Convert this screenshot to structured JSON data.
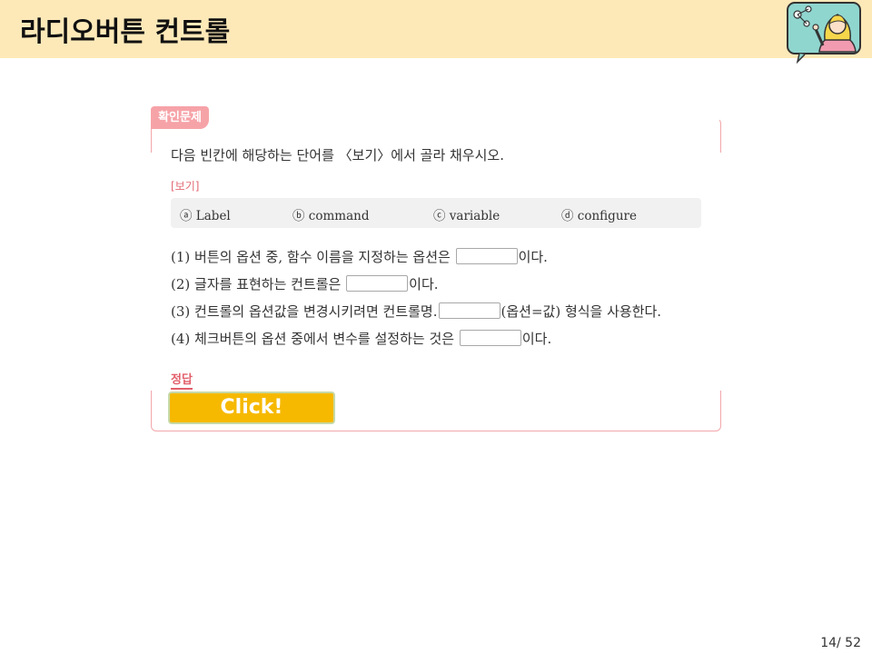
{
  "header": {
    "title": "라디오버튼 컨트롤"
  },
  "quiz": {
    "badge": "확인문제",
    "instruction": "다음 빈칸에 해당하는 단어를 〈보기〉에서 골라 채우시오.",
    "bogi_label": "[보기]",
    "options": [
      "ⓐ Label",
      "ⓑ command",
      "ⓒ variable",
      "ⓓ configure"
    ],
    "questions": [
      {
        "before": "(1) 버튼의 옵션 중, 함수 이름을 지정하는 옵션은",
        "after": "이다."
      },
      {
        "before": "(2) 글자를 표현하는 컨트롤은",
        "after": "이다."
      },
      {
        "before": "(3) 컨트롤의 옵션값을 변경시키려면 컨트롤명.",
        "after": "(옵션=값) 형식을 사용한다."
      },
      {
        "before": "(4) 체크버튼의 옵션 중에서 변수를 설정하는 것은",
        "after": "이다."
      }
    ],
    "answer_label": "정답",
    "click_label": "Click!"
  },
  "footer": {
    "page": "14/ 52"
  },
  "colors": {
    "header_bg": "#fde9b8",
    "accent_pink": "#f6a3a8",
    "button": "#f6b900"
  },
  "icons": {
    "avatar": "presenter-avatar-icon"
  }
}
